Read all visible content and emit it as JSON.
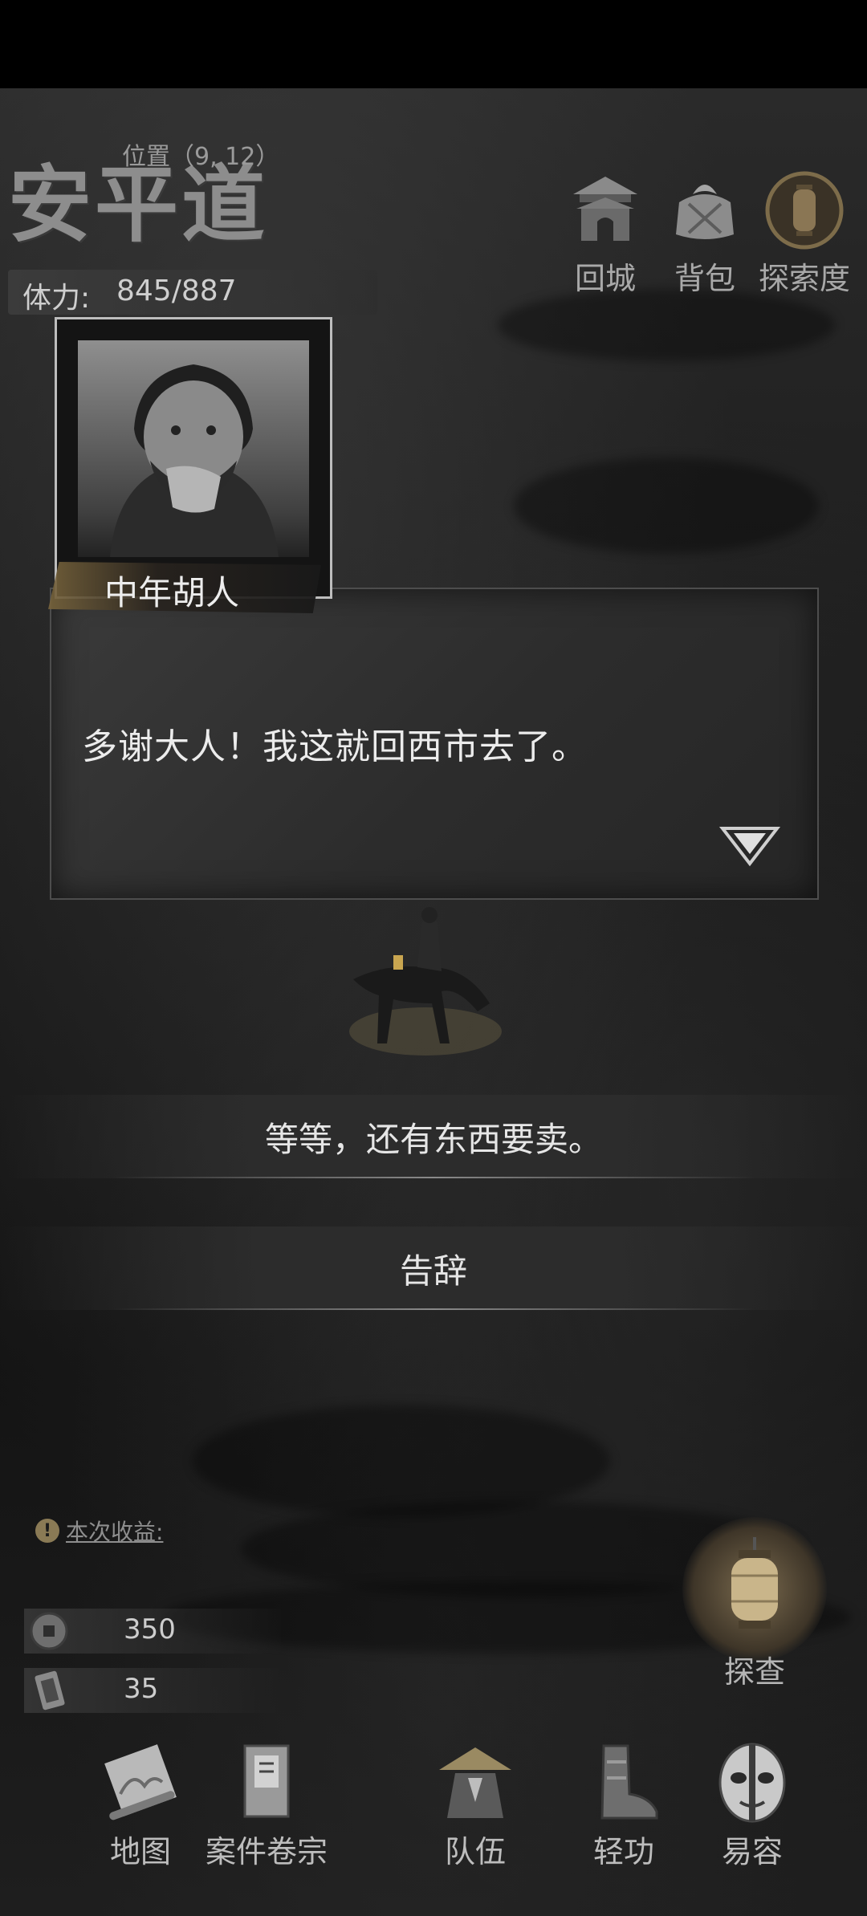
{
  "header": {
    "location_name": "安平道",
    "position_label": "位置（9, 12）",
    "stamina_label": "体力:",
    "stamina_value": "845/887",
    "buttons": [
      {
        "label": "回城",
        "icon": "city-gate-icon"
      },
      {
        "label": "背包",
        "icon": "bundle-icon"
      },
      {
        "label": "探索度",
        "icon": "lantern-icon"
      }
    ]
  },
  "dialog": {
    "npc_name": "中年胡人",
    "text": "多谢大人！我这就回西市去了。",
    "next_icon": "triangle-down-icon"
  },
  "choices": [
    {
      "label": "等等，还有东西要卖。"
    },
    {
      "label": "告辞"
    }
  ],
  "earnings": {
    "label": "本次收益:",
    "items": [
      {
        "icon": "coin-icon",
        "value": "350"
      },
      {
        "icon": "scroll-token-icon",
        "value": "35"
      }
    ]
  },
  "explore": {
    "label": "探查",
    "icon": "lantern-icon"
  },
  "bottom_nav": [
    {
      "label": "地图",
      "icon": "map-scroll-icon"
    },
    {
      "label": "案件卷宗",
      "icon": "case-file-icon"
    },
    {
      "label": "队伍",
      "icon": "straw-hat-icon"
    },
    {
      "label": "轻功",
      "icon": "boots-icon"
    },
    {
      "label": "易容",
      "icon": "mask-icon"
    }
  ],
  "colors": {
    "accent_gold": "#8a7a55",
    "background": "#161616"
  }
}
